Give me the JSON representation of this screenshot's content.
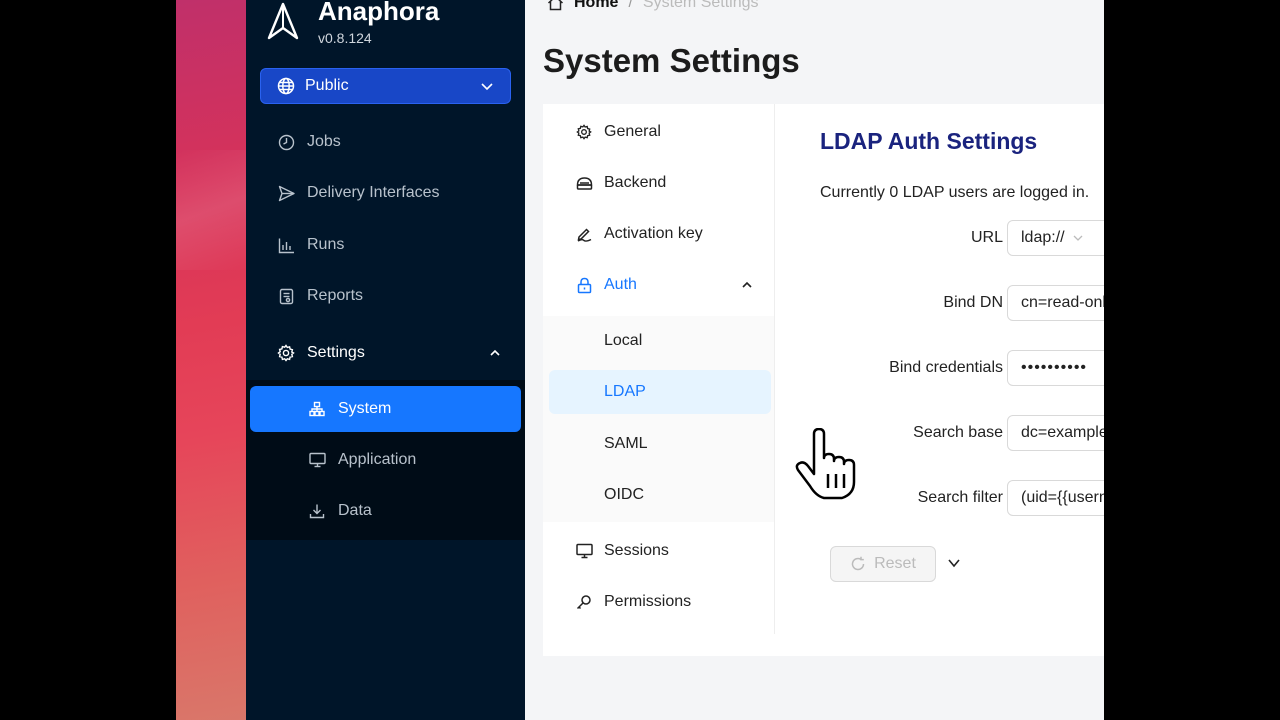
{
  "app": {
    "name": "Anaphora",
    "version": "v0.8.124"
  },
  "namespace_select": {
    "value": "Public"
  },
  "sidebar": {
    "items": [
      {
        "label": "Jobs",
        "icon": "clock-icon"
      },
      {
        "label": "Delivery Interfaces",
        "icon": "send-icon"
      },
      {
        "label": "Runs",
        "icon": "bar-chart-icon"
      },
      {
        "label": "Reports",
        "icon": "report-icon"
      },
      {
        "label": "Settings",
        "icon": "gear-icon"
      }
    ],
    "settings_sub": [
      {
        "label": "System",
        "icon": "hierarchy-icon"
      },
      {
        "label": "Application",
        "icon": "monitor-icon"
      },
      {
        "label": "Data",
        "icon": "download-icon"
      }
    ]
  },
  "breadcrumb": {
    "home": "Home",
    "separator": "/",
    "current": "System Settings"
  },
  "page": {
    "title": "System Settings"
  },
  "settings_menu": {
    "items": [
      {
        "label": "General",
        "icon": "gear-icon"
      },
      {
        "label": "Backend",
        "icon": "database-icon"
      },
      {
        "label": "Activation key",
        "icon": "signature-icon"
      },
      {
        "label": "Auth",
        "icon": "lock-icon"
      },
      {
        "label": "Sessions",
        "icon": "monitor-icon"
      },
      {
        "label": "Permissions",
        "icon": "key-icon"
      }
    ],
    "auth_sub": [
      {
        "label": "Local"
      },
      {
        "label": "LDAP"
      },
      {
        "label": "SAML"
      },
      {
        "label": "OIDC"
      }
    ]
  },
  "ldap": {
    "title": "LDAP Auth Settings",
    "note": "Currently 0 LDAP users are logged in.",
    "url_label": "URL",
    "url_value": "ldap://",
    "bind_dn_label": "Bind DN",
    "bind_dn_value": "cn=read-only",
    "bind_cred_label": "Bind credentials",
    "bind_cred_value": "••••••••••",
    "search_base_label": "Search base",
    "search_base_value": "dc=example",
    "search_filter_label": "Search filter",
    "search_filter_value": "(uid={{username}})",
    "reset_label": "Reset"
  },
  "colors": {
    "sidebar_bg": "#001529",
    "accent": "#1677ff",
    "title_navy": "#1a237e"
  }
}
